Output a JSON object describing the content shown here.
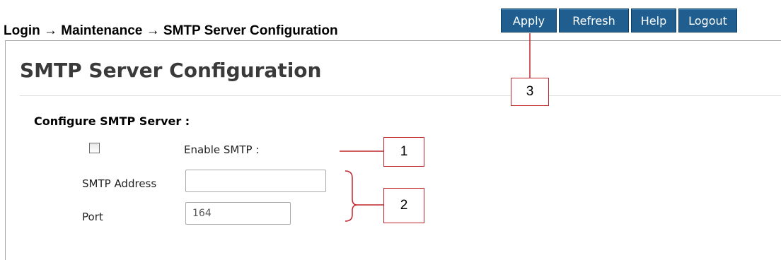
{
  "caption": "Login → Maintenance → SMTP Server Configuration",
  "nav": {
    "apply": "Apply",
    "refresh": "Refresh",
    "help": "Help",
    "logout": "Logout"
  },
  "page": {
    "title": "SMTP Server Configuration",
    "section_title": "Configure SMTP Server :"
  },
  "form": {
    "enable_label": "Enable SMTP :",
    "enable_checked": false,
    "address_label": "SMTP Address",
    "address_value": "",
    "port_label": "Port",
    "port_value": "164"
  },
  "callouts": {
    "one": "1",
    "two": "2",
    "three": "3"
  },
  "colors": {
    "nav_button": "#1f5e8e",
    "callout_red": "#c0262b"
  }
}
